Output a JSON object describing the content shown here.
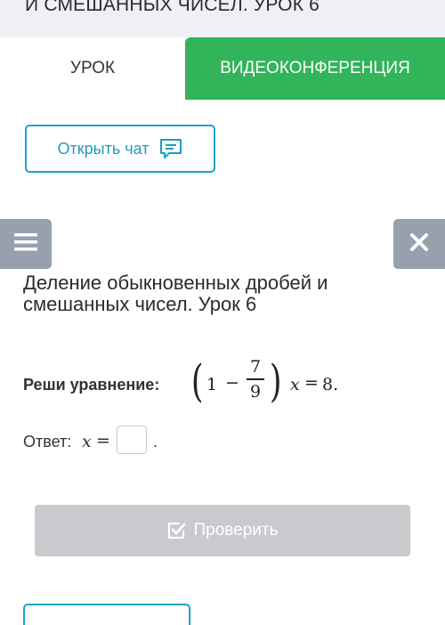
{
  "course_title": "И СМЕШАННЫХ ЧИСЕЛ. УРОК 6",
  "tabs": [
    {
      "label": "УРОК",
      "active": true
    },
    {
      "label": "ВИДЕОКОНФЕРЕНЦИЯ",
      "active": false
    }
  ],
  "chat_button": {
    "label": "Открыть чат",
    "icon": "chat-icon"
  },
  "menu_button": {
    "icon": "hamburger-menu-icon"
  },
  "close_button": {
    "icon": "close-icon"
  },
  "lesson_title": "Деление обыкновенных дробей и смешанных чисел. Урок 6",
  "task": {
    "label": "Реши уравнение:",
    "formula": {
      "one": "1",
      "minus": "−",
      "numerator": "7",
      "denominator": "9",
      "variable": "x",
      "equals": "=",
      "rhs": "8."
    }
  },
  "answer": {
    "label": "Ответ:",
    "variable": "x",
    "equals": "=",
    "value": "",
    "trailing": "."
  },
  "check_button": {
    "label": "Проверить",
    "icon": "checkbox-check-icon"
  },
  "colors": {
    "accent_green": "#32b45a",
    "accent_blue": "#1fa2c8",
    "side_button_gray": "#97a1ad",
    "disabled_button": "#c8cacd"
  }
}
